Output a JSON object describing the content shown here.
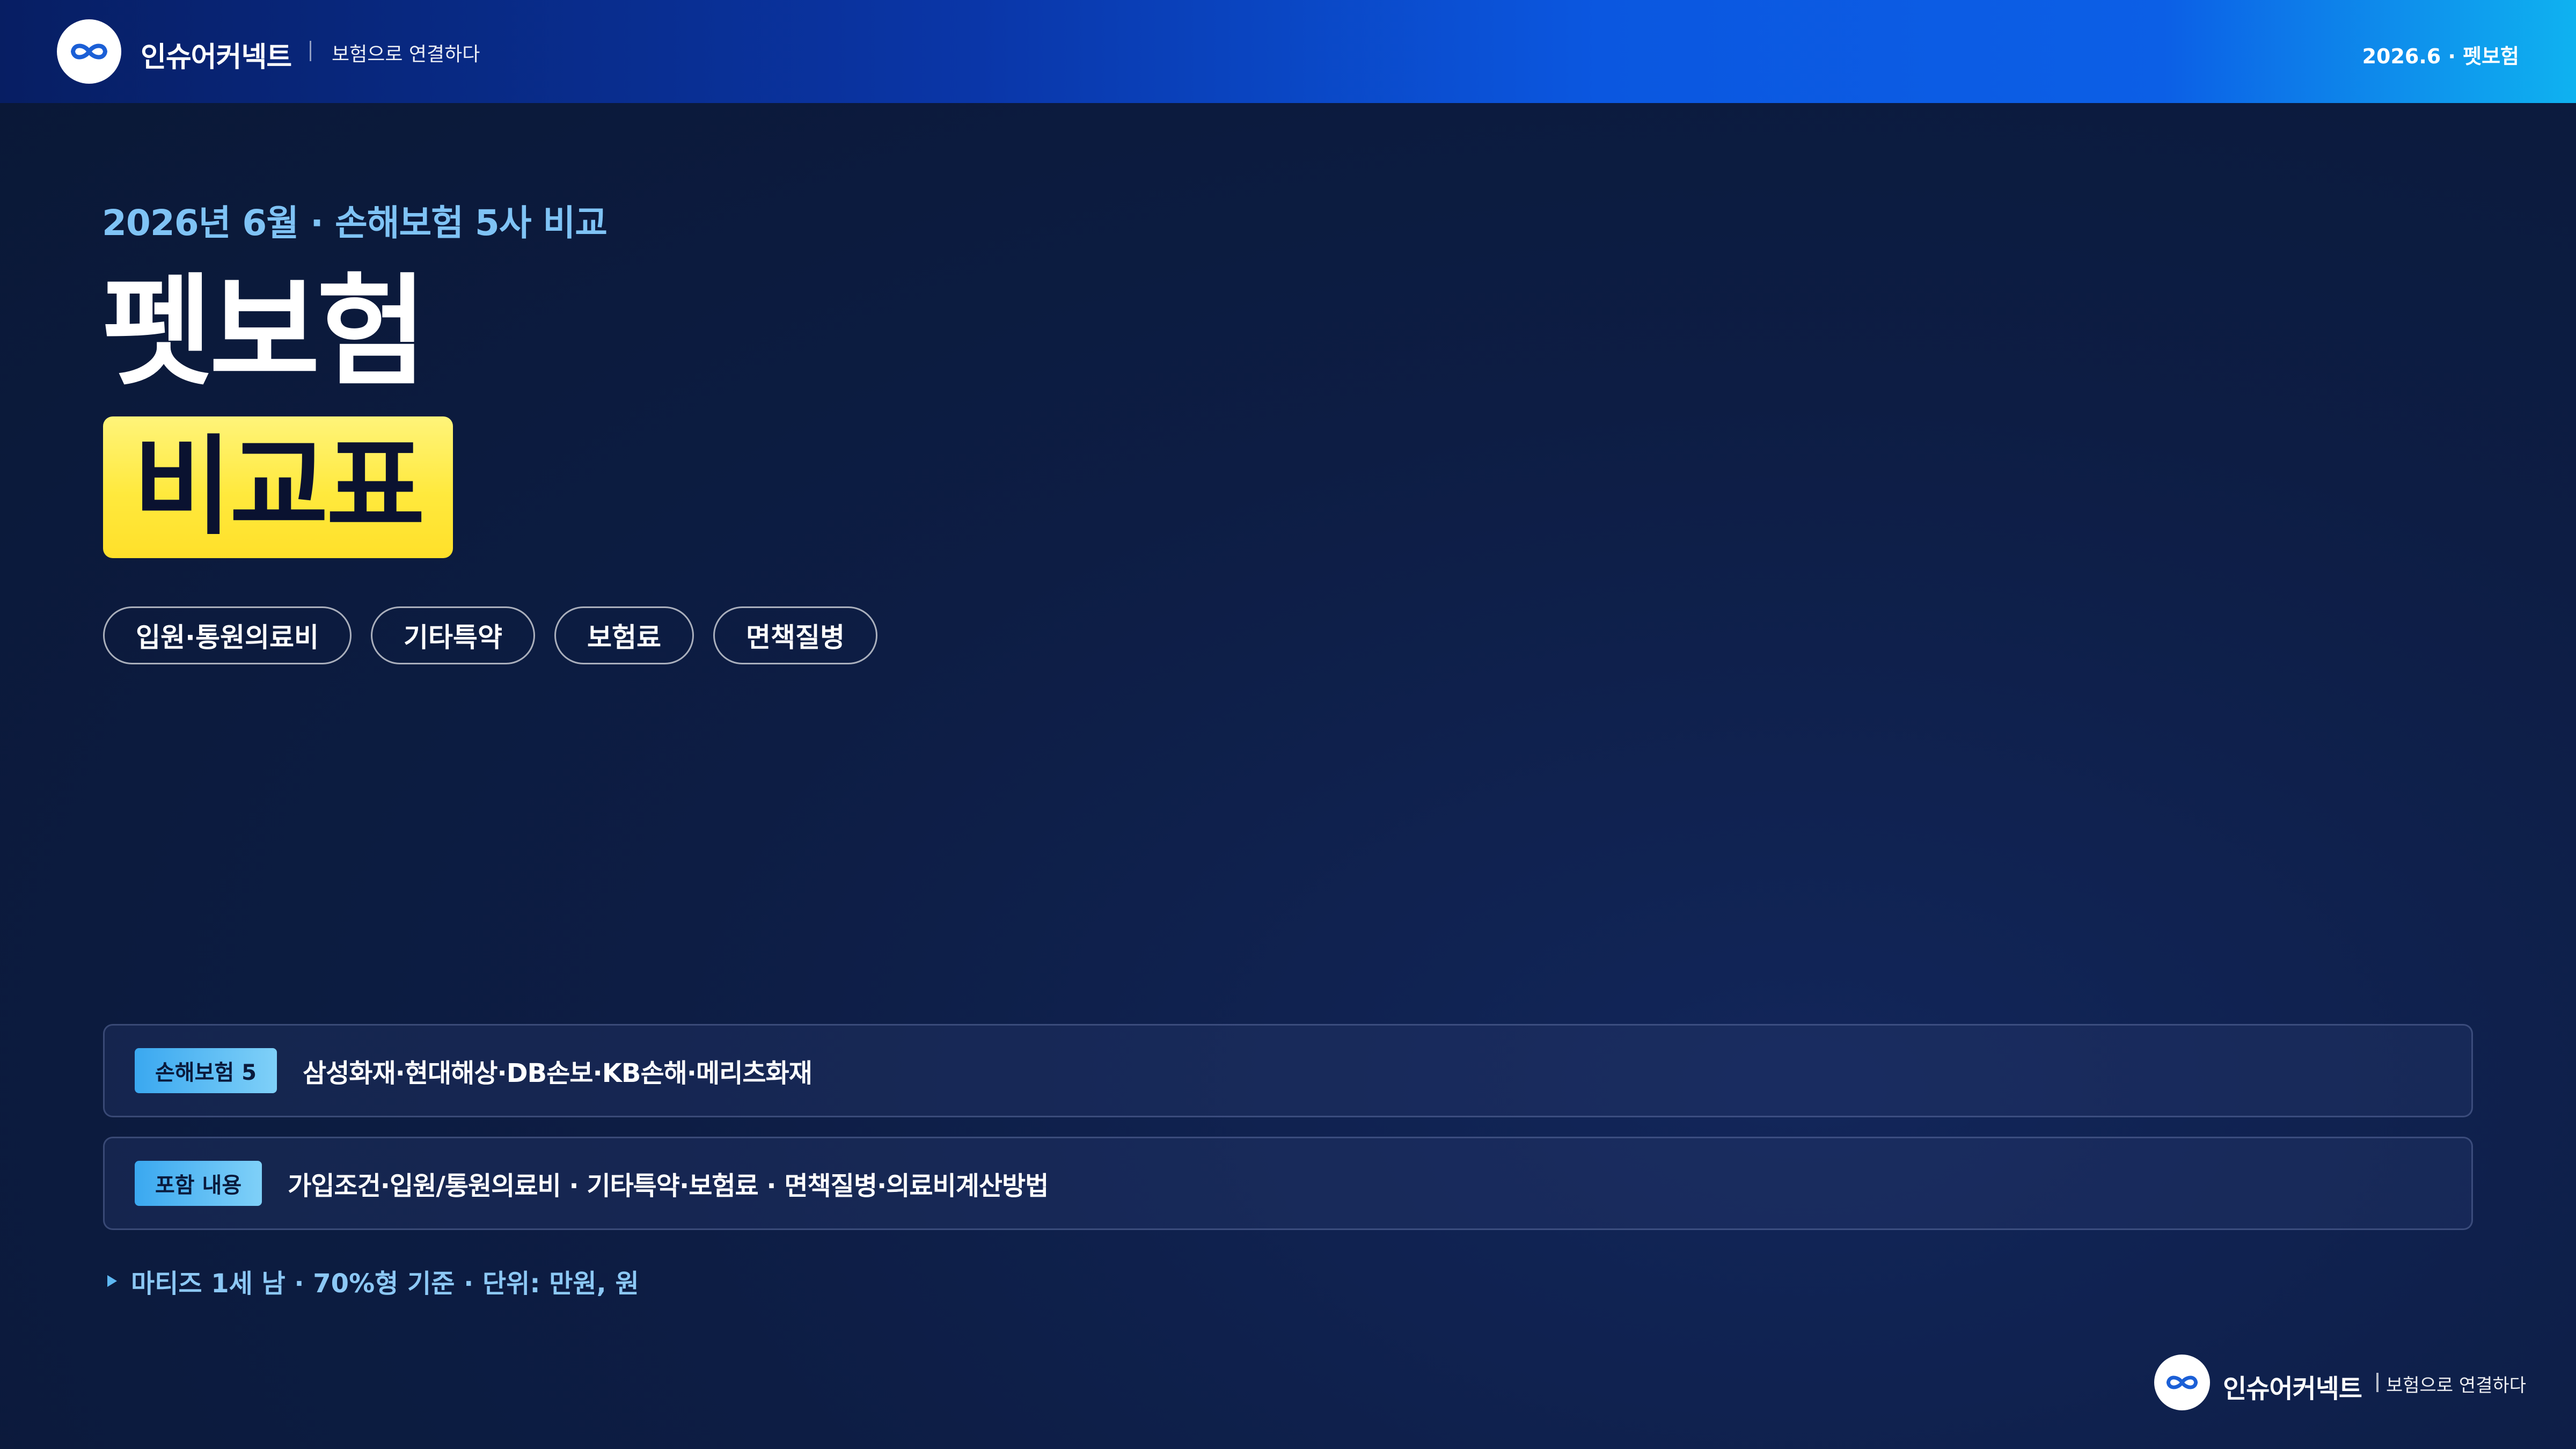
{
  "header": {
    "brand_name": "인슈어커넥트",
    "tagline": "보험으로 연결하다",
    "right_label": "2026.6 · 펫보험"
  },
  "hero": {
    "subtitle": "2026년 6월 · 손해보험 5사 비교",
    "title": "펫보험",
    "title_highlight": "비교표"
  },
  "pills": [
    {
      "label": "입원·통원의료비"
    },
    {
      "label": "기타특약"
    },
    {
      "label": "보험료"
    },
    {
      "label": "면책질병"
    }
  ],
  "info_rows": [
    {
      "badge": "손해보험 5",
      "text": "삼성화재·현대해상·DB손보·KB손해·메리츠화재"
    },
    {
      "badge": "포함 내용",
      "text": "가입조건·입원/통원의료비 · 기타특약·보험료 · 면책질병·의료비계산방법"
    }
  ],
  "note": {
    "icon": "triangle-bullet-icon",
    "text": "마티즈 1세 남 · 70%형 기준 · 단위: 만원, 원"
  },
  "footer": {
    "brand_name": "인슈어커넥트",
    "tagline": "보험으로 연결하다"
  },
  "colors": {
    "background": "#0d1d44",
    "accent_yellow": "#ffe93d",
    "accent_blue": "#0b57e0",
    "subtitle_blue": "#7fc3f5",
    "badge_blue": "#5ebef4"
  }
}
